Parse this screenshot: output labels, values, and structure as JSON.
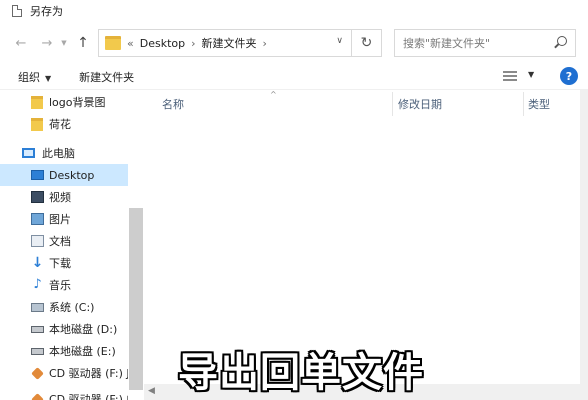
{
  "window": {
    "title": "另存为"
  },
  "nav": {
    "breadcrumb_prefix": "«",
    "breadcrumbs": [
      "Desktop",
      "新建文件夹"
    ],
    "search_placeholder": "搜索\"新建文件夹\""
  },
  "toolbar": {
    "organize_label": "组织",
    "new_folder_label": "新建文件夹"
  },
  "sidebar": {
    "items": [
      {
        "label": "logo背景图",
        "icon": "folder-icon"
      },
      {
        "label": "荷花",
        "icon": "folder-icon"
      },
      {
        "label": "此电脑",
        "icon": "pc-icon"
      },
      {
        "label": "Desktop",
        "icon": "desktop-icon"
      },
      {
        "label": "视频",
        "icon": "video-icon"
      },
      {
        "label": "图片",
        "icon": "pictures-icon"
      },
      {
        "label": "文档",
        "icon": "documents-icon"
      },
      {
        "label": "下载",
        "icon": "download-icon"
      },
      {
        "label": "音乐",
        "icon": "music-icon"
      },
      {
        "label": "系统 (C:)",
        "icon": "system-drive-icon"
      },
      {
        "label": "本地磁盘 (D:)",
        "icon": "drive-icon"
      },
      {
        "label": "本地磁盘 (E:)",
        "icon": "drive-icon"
      },
      {
        "label": "CD 驱动器 (F:) J",
        "icon": "cd-drive-icon"
      },
      {
        "label": "CD 驱动器 (F:) 中",
        "icon": "cd-drive-icon"
      }
    ]
  },
  "columns": {
    "name": "名称",
    "modified": "修改日期",
    "type": "类型"
  },
  "caption": "导出回单文件"
}
